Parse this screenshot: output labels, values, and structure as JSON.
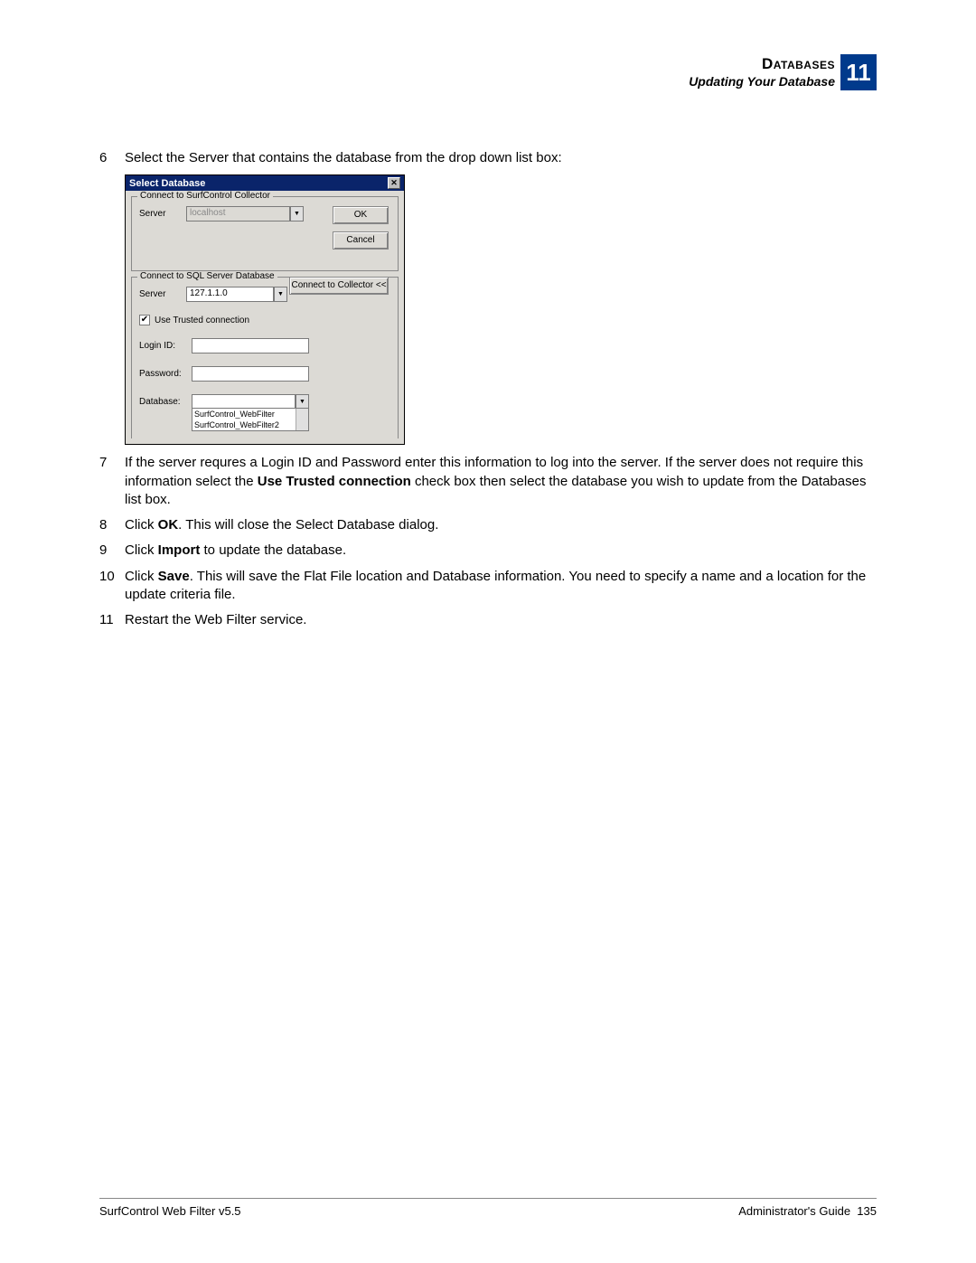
{
  "header": {
    "title": "Databases",
    "subtitle": "Updating Your Database",
    "chapter": "11"
  },
  "steps": {
    "s6": {
      "num": "6",
      "text": "Select the Server that contains the database from the drop down list box:"
    },
    "s7": {
      "num": "7",
      "pre": "If the server requres a Login ID and Password enter this information to log into the server. If the server does not require this information select the ",
      "bold": "Use Trusted connection",
      "post": " check box then select the database you wish to update from the Databases list box."
    },
    "s8": {
      "num": "8",
      "pre": "Click ",
      "bold": "OK",
      "post": ". This will close the Select Database dialog."
    },
    "s9": {
      "num": "9",
      "pre": "Click ",
      "bold": "Import",
      "post": " to update the database."
    },
    "s10": {
      "num": "10",
      "pre": "Click ",
      "bold": "Save",
      "post": ". This will save the Flat File location and Database information. You need to specify a name and a location for the update criteria file."
    },
    "s11": {
      "num": "11",
      "text": "Restart the Web Filter service."
    }
  },
  "dialog": {
    "title": "Select Database",
    "group1": {
      "label": "Connect to SurfControl Collector",
      "server_label": "Server",
      "server_value": "localhost",
      "ok": "OK",
      "cancel": "Cancel",
      "connect": "Connect to Collector <<"
    },
    "group2": {
      "label": "Connect to SQL Server Database",
      "server_label": "Server",
      "server_value": "127.1.1.0",
      "trusted": "Use Trusted connection",
      "login_label": "Login ID:",
      "password_label": "Password:",
      "database_label": "Database:",
      "db_item1": "SurfControl_WebFilter",
      "db_item2": "SurfControl_WebFilter2"
    }
  },
  "footer": {
    "left": "SurfControl Web Filter v5.5",
    "right_label": "Administrator's Guide",
    "page": "135"
  }
}
